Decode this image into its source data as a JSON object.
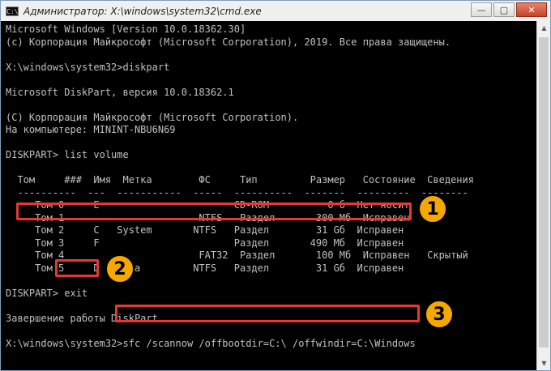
{
  "window": {
    "title": "Администратор: X:\\windows\\system32\\cmd.exe",
    "app_icon": "C:\\",
    "minimize_icon": "—",
    "maximize_icon": "▢",
    "close_icon": "✕"
  },
  "scrollbar": {
    "up_icon": "▲",
    "down_icon": "▼"
  },
  "console": {
    "lines": [
      "Microsoft Windows [Version 10.0.18362.30]",
      "(c) Корпорация Майкрософт (Microsoft Corporation), 2019. Все права защищены.",
      "",
      "X:\\windows\\system32>diskpart",
      "",
      "Microsoft DiskPart, версия 10.0.18362.1",
      "",
      "(C) Корпорация Майкрософт (Microsoft Corporation).",
      "На компьютере: MININT-NBU6N69",
      "",
      "DISKPART> list volume",
      "",
      "  Том     ###  Имя  Метка        ФС     Тип         Размер   Состояние  Сведения",
      "  ----------  ---  -----------  -----  ----------  -------  ---------  --------",
      "     Том 0     E                       CD-ROM          0 б  Нет носит",
      "     Том 1                       NTFS   Раздел       300 Мб  Исправен",
      "     Том 2     C   System       NTFS   Раздел        31 Gб  Исправен",
      "     Том 3     F                       Раздел       490 Мб  Исправен",
      "     Том 4                       FAT32  Раздел       100 Мб  Исправен   Скрытый",
      "     Том 5     D   Data         NTFS   Раздел        31 Gб  Исправен",
      "",
      "DISKPART> exit",
      "",
      "Завершение работы DiskPart...",
      "",
      "X:\\windows\\system32>sfc /scannow /offbootdir=C:\\ /offwindir=C:\\Windows"
    ]
  },
  "annotations": {
    "badge_1": "1",
    "badge_2": "2",
    "badge_3": "3"
  }
}
